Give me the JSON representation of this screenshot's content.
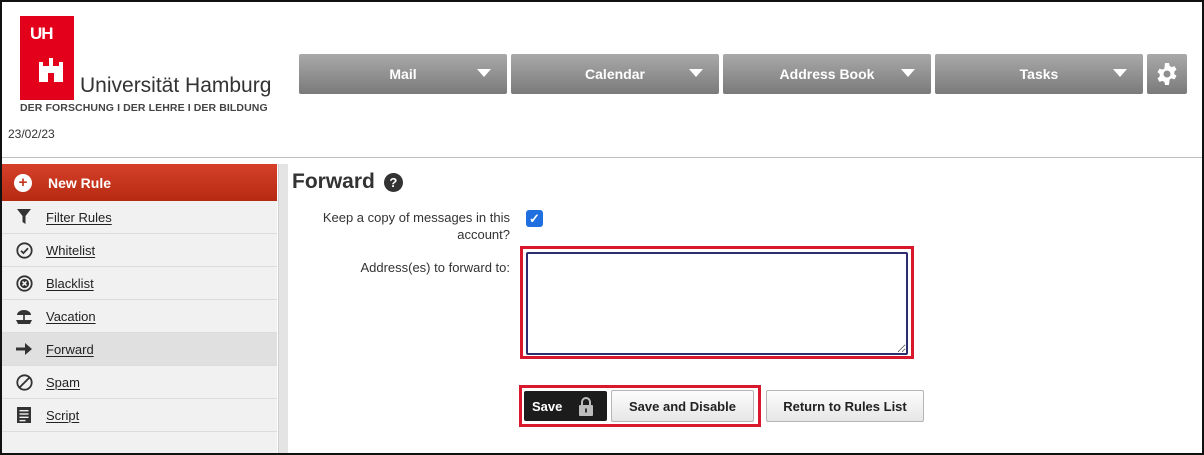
{
  "logo": {
    "mark_text": "UHH",
    "name": "Universität Hamburg",
    "tagline": "DER FORSCHUNG I DER LEHRE I DER BILDUNG"
  },
  "date": "23/02/23",
  "nav": {
    "tabs": [
      {
        "label": "Mail"
      },
      {
        "label": "Calendar"
      },
      {
        "label": "Address Book"
      },
      {
        "label": "Tasks"
      }
    ],
    "settings_icon": "gear-icon"
  },
  "sidebar": {
    "new_rule": "New Rule",
    "items": [
      {
        "label": "Filter Rules",
        "icon": "funnel-icon"
      },
      {
        "label": "Whitelist",
        "icon": "check-circle-icon"
      },
      {
        "label": "Blacklist",
        "icon": "x-circle-icon"
      },
      {
        "label": "Vacation",
        "icon": "vacation-icon"
      },
      {
        "label": "Forward",
        "icon": "arrow-right-icon",
        "active": true
      },
      {
        "label": "Spam",
        "icon": "no-sign-icon"
      },
      {
        "label": "Script",
        "icon": "script-icon"
      }
    ]
  },
  "main": {
    "title": "Forward",
    "keep_copy_label": "Keep a copy of messages in this account?",
    "keep_copy_checked": true,
    "address_label": "Address(es) to forward to:",
    "address_value": "",
    "buttons": {
      "save": "Save",
      "save_disable": "Save and Disable",
      "return": "Return to Rules List"
    }
  },
  "colors": {
    "brand_red": "#e2001a",
    "highlight": "#d9182d",
    "checkbox_blue": "#1f6fe0"
  }
}
